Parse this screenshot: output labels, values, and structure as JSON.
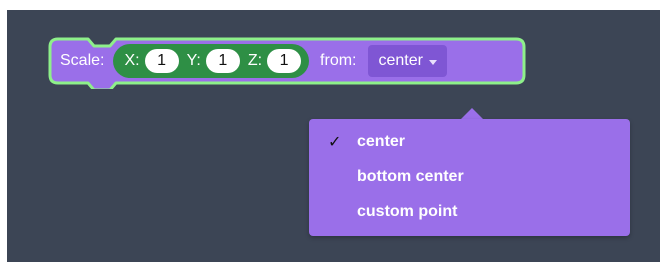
{
  "block": {
    "scale_label": "Scale:",
    "x_label": "X:",
    "x_value": "1",
    "y_label": "Y:",
    "y_value": "1",
    "z_label": "Z:",
    "z_value": "1",
    "from_label": "from:",
    "from_value": "center"
  },
  "menu": {
    "items": [
      {
        "label": "center",
        "checked": true,
        "check_glyph": "✓"
      },
      {
        "label": "bottom center",
        "checked": false
      },
      {
        "label": "custom point",
        "checked": false
      }
    ]
  },
  "colors": {
    "workspace": "#3c4555",
    "block_fill": "#9a6fe9",
    "block_outline": "#8ef08a",
    "vector_fill": "#2e8f45",
    "dropdown_fill": "#7f56d4",
    "menu_fill": "#9a6fe9"
  },
  "icons": {
    "dropdown_caret": "caret-down-icon",
    "checkmark": "checkmark-icon"
  }
}
